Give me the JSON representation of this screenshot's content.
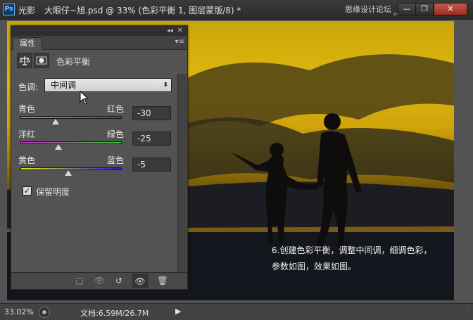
{
  "window": {
    "app_icon": "Ps",
    "app_name": "光影",
    "document_title": "大眼仔~旭.psd @ 33% (色彩平衡 1, 图层蒙版/8) *",
    "watermark": "思缘设计论坛",
    "watermark_url": "www.MISSVUAN.COM",
    "min_label": "—",
    "max_label": "❐",
    "close_label": "✕"
  },
  "panel": {
    "tab_label": "属性",
    "collapse_glyph": "◂◂",
    "close_glyph": "✕",
    "menu_glyph": "▾≡",
    "adjustment_title": "色彩平衡",
    "tone": {
      "label": "色调:",
      "selected": "中间调",
      "arrow_glyph": "⬍"
    },
    "sliders": [
      {
        "left": "青色",
        "right": "红色",
        "value": -30,
        "value_text": "-30"
      },
      {
        "left": "洋红",
        "right": "绿色",
        "value": -25,
        "value_text": "-25"
      },
      {
        "left": "黄色",
        "right": "蓝色",
        "value": -5,
        "value_text": "-5"
      }
    ],
    "slider_range": [
      -100,
      100
    ],
    "preserve_luminosity": {
      "label": "保留明度",
      "checked": true,
      "check_glyph": "✓"
    },
    "bottom_buttons": {
      "clip": "⬚",
      "view_previous": "👁",
      "reset": "↺",
      "visibility": "👁",
      "delete": "🗑",
      "grip": "·····"
    }
  },
  "canvas": {
    "caption_line1": "6.创建色彩平衡，调整中间调，细调色彩，",
    "caption_line2": "参数如图，效果如图。"
  },
  "statusbar": {
    "zoom": "33.02%",
    "doc_info": "文档:6.59M/26.7M",
    "arrow": "▶",
    "grip": "⋰"
  },
  "colors": {
    "sky_yellow": "#e0b810",
    "panel_bg": "#535353"
  }
}
